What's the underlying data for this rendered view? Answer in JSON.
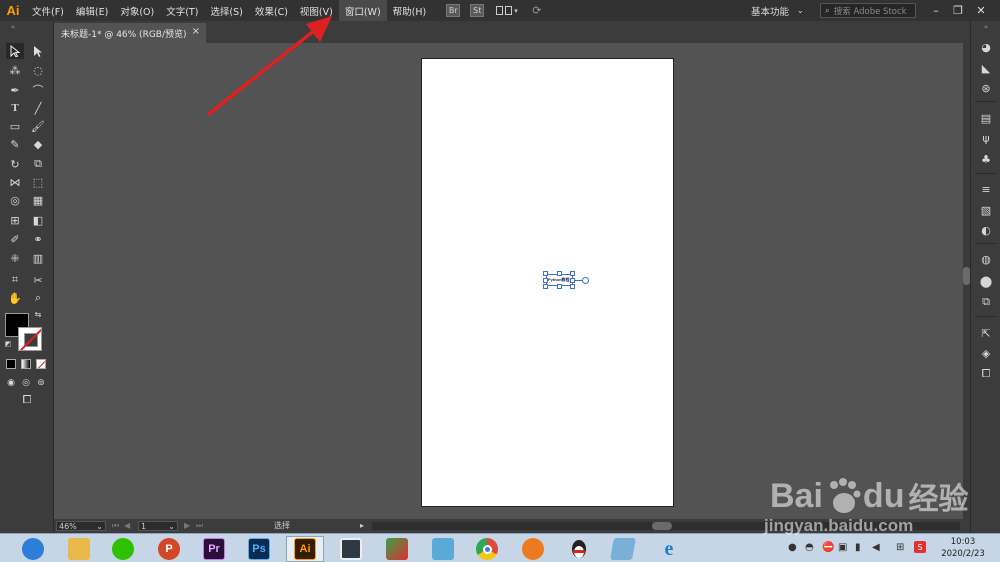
{
  "app": {
    "logo": "Ai"
  },
  "menubar": {
    "items": [
      "文件(F)",
      "编辑(E)",
      "对象(O)",
      "文字(T)",
      "选择(S)",
      "效果(C)",
      "视图(V)",
      "窗口(W)",
      "帮助(H)"
    ],
    "bridge_label": "Br",
    "stock_label": "St",
    "workspace_label": "基本功能",
    "search_placeholder": "搜索 Adobe Stock"
  },
  "document_tab": {
    "title": "未标题-1* @ 46% (RGB/预览)",
    "close": "×"
  },
  "canvas": {
    "selected_text": "Python教程"
  },
  "statusbar": {
    "zoom": "46%",
    "page": "1",
    "tool": "选择"
  },
  "taskbar": {
    "apps": [
      {
        "name": "qq-browser",
        "glyph": "",
        "color": "#2c7fd6"
      },
      {
        "name": "file-explorer",
        "glyph": "",
        "color": "#e8b84a"
      },
      {
        "name": "wechat",
        "glyph": "",
        "color": "#2dc100"
      },
      {
        "name": "powerpoint",
        "glyph": "P",
        "color": "#d24726"
      },
      {
        "name": "premiere",
        "glyph": "Pr",
        "color": "#2a0f3a"
      },
      {
        "name": "photoshop",
        "glyph": "Ps",
        "color": "#0d2b4e"
      },
      {
        "name": "illustrator",
        "glyph": "Ai",
        "color": "#331c00"
      },
      {
        "name": "video-editor",
        "glyph": "",
        "color": "#2c3a46"
      },
      {
        "name": "app-green",
        "glyph": "",
        "color": "#3aa04a"
      },
      {
        "name": "app-bird",
        "glyph": "",
        "color": "#5aaad8"
      },
      {
        "name": "chrome",
        "glyph": "",
        "color": "#e04a3a"
      },
      {
        "name": "app-orange",
        "glyph": "",
        "color": "#ee7a20"
      },
      {
        "name": "qq",
        "glyph": "",
        "color": "#222222"
      },
      {
        "name": "notepad",
        "glyph": "",
        "color": "#7ab0d8"
      },
      {
        "name": "internet-explorer",
        "glyph": "e",
        "color": "#1d7ad8"
      }
    ],
    "clock_time": "10:03",
    "clock_date": "2020/2/23"
  },
  "watermark": {
    "brand": "Bai",
    "brand2": "du",
    "brand3": "经验",
    "url": "jingyan.baidu.com"
  },
  "colors": {
    "accent_arrow": "#e02020",
    "ai_orange": "#ff9a00",
    "selection_blue": "#3a70d8"
  }
}
